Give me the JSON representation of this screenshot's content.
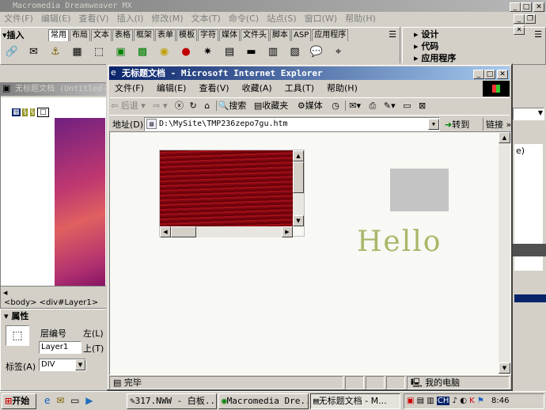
{
  "dw": {
    "title": "Macromedia Dreamweaver MX",
    "menu": [
      "文件(F)",
      "编辑(E)",
      "查看(V)",
      "插入(I)",
      "修改(M)",
      "文本(T)",
      "命令(C)",
      "站点(S)",
      "窗口(W)",
      "帮助(H)"
    ],
    "insert_label": "插入",
    "insert_tabs": [
      "常用",
      "布局",
      "文本",
      "表格",
      "框架",
      "表单",
      "模板",
      "字符",
      "媒体",
      "文件头",
      "脚本",
      "ASP",
      "应用程序"
    ],
    "panels": [
      "设计",
      "代码",
      "应用程序"
    ],
    "doc_title": "无标题文档 (Untitled-",
    "tag_selector": "<body> <div#Layer1>",
    "props": {
      "header": "属性",
      "layer_id_label": "层编号",
      "layer_id_value": "Layer1",
      "left_label": "左(L)",
      "top_label": "上(T)",
      "tag_label": "标签(A)",
      "tag_value": "DIV"
    },
    "right_edge_labels": [
      "e)"
    ]
  },
  "ie": {
    "title": "无标题文档 - Microsoft Internet Explorer",
    "menu": [
      "文件(F)",
      "编辑(E)",
      "查看(V)",
      "收藏(A)",
      "工具(T)",
      "帮助(H)"
    ],
    "toolbar": {
      "back": "后退",
      "search": "搜索",
      "favorites": "收藏夹",
      "media": "媒体"
    },
    "address_label": "地址(D)",
    "address_value": "D:\\MySite\\TMP236zepo7gu.htm",
    "go_label": "转到",
    "links_label": "链接",
    "hello_text": "Hello",
    "status_left": "完毕",
    "status_right": "我的电脑"
  },
  "taskbar": {
    "start": "开始",
    "tasks": [
      "317.NWW - 白板...",
      "Macromedia Dre...",
      "无标题文档 - M..."
    ],
    "clock": "8:46",
    "ime": "CH"
  },
  "colors": {
    "active_title": "#0a246a",
    "hello_text": "#a8b86a",
    "red_image": "#8a0a10",
    "gray_box": "#c4c4c4"
  }
}
